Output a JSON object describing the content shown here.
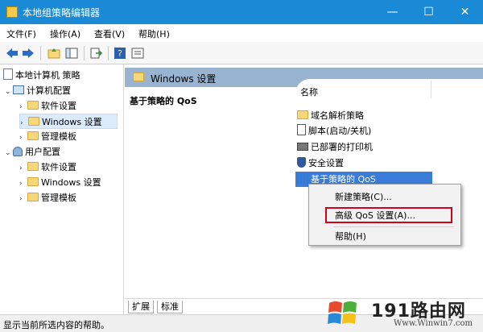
{
  "window": {
    "title": "本地组策略编辑器",
    "minimize": "—",
    "maximize": "☐",
    "close": "✕"
  },
  "menu": {
    "items": [
      "文件(F)",
      "操作(A)",
      "查看(V)",
      "帮助(H)"
    ]
  },
  "toolbar": {
    "icons": [
      "back-arrow-icon",
      "forward-arrow-icon",
      "up-folder-icon",
      "show-hide-tree-icon",
      "export-list-icon",
      "help-icon",
      "properties-icon"
    ]
  },
  "tree": {
    "root": "本地计算机 策略",
    "computer_config": "计算机配置",
    "computer_children": [
      "软件设置",
      "Windows 设置",
      "管理模板"
    ],
    "user_config": "用户配置",
    "user_children": [
      "软件设置",
      "Windows 设置",
      "管理模板"
    ],
    "selected": "Windows 设置"
  },
  "main": {
    "header": "Windows 设置",
    "description_title": "基于策略的 QoS",
    "column_name": "名称",
    "items": [
      {
        "label": "域名解析策略",
        "icon": "folder-icon"
      },
      {
        "label": "脚本(启动/关机)",
        "icon": "script-icon"
      },
      {
        "label": "已部署的打印机",
        "icon": "printer-icon"
      },
      {
        "label": "安全设置",
        "icon": "security-icon"
      },
      {
        "label": "基于策略的 QoS",
        "icon": "qos-chart-icon",
        "selected": true
      }
    ]
  },
  "context_menu": {
    "items": [
      "新建策略(C)...",
      "高级 QoS 设置(A)...",
      "帮助(H)"
    ],
    "highlighted": "高级 QoS 设置(A)...",
    "highlight_color": "#d0021b"
  },
  "tabs": [
    "扩展",
    "标准"
  ],
  "status": "显示当前所选内容的帮助。",
  "watermark": {
    "big": "191路由网",
    "small": "Www.Winwin7.com"
  },
  "colors": {
    "titlebar": "#1b8ad6",
    "header_band": "#99b4d1",
    "selection": "#3a7cd8"
  }
}
